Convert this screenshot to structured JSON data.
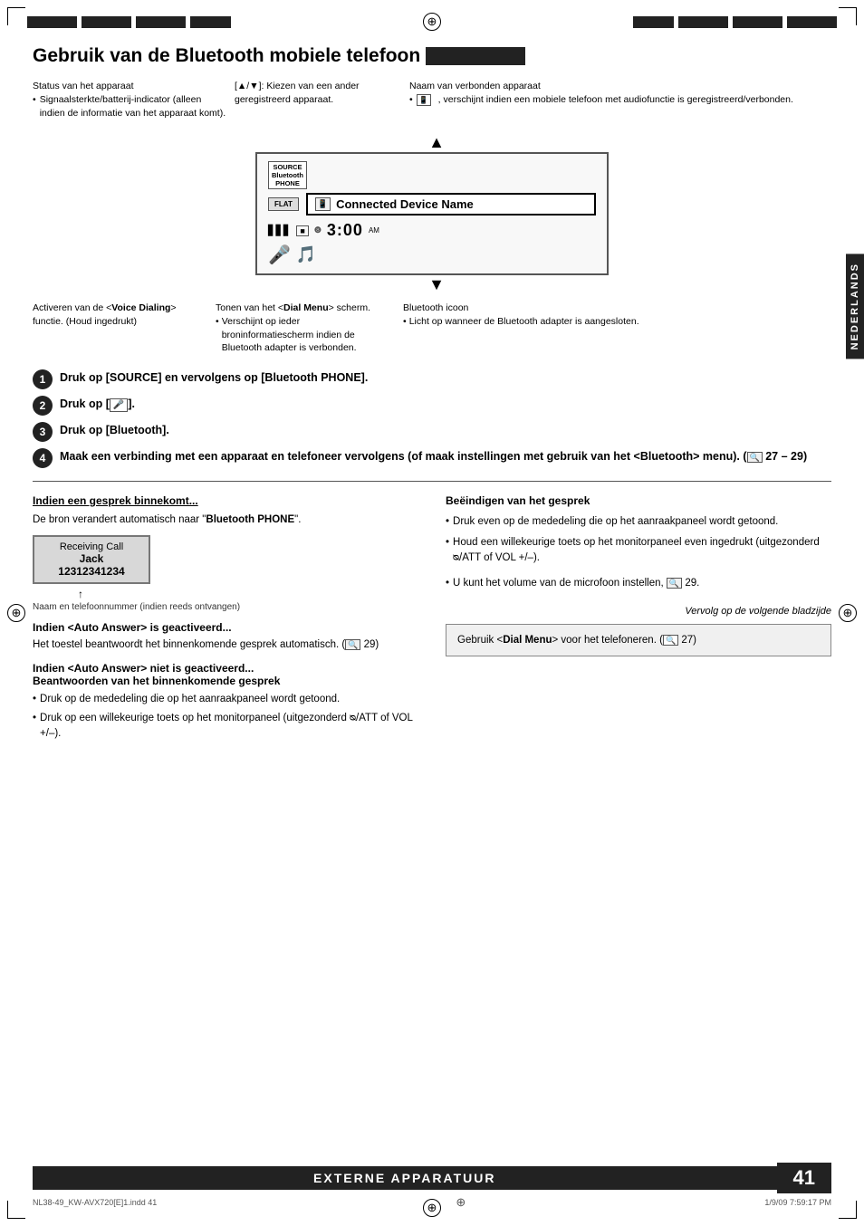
{
  "page": {
    "title": "Gebruik van de Bluetooth mobiele telefoon",
    "title_bar": "■",
    "sidebar_label": "NEDERLANDS"
  },
  "header": {
    "top_bars": [
      "left-bar",
      "right-bar"
    ],
    "reg_symbol": "⊕"
  },
  "desc_top": {
    "col1_label": "Status van het apparaat",
    "col1_bullet": "Signaalsterkte/batterij-indicator (alleen indien de informatie van het apparaat komt).",
    "col2_label": "[▲/▼]: Kiezen van een ander geregistreerd apparaat.",
    "col3_label": "Naam van verbonden apparaat",
    "col3_bullet": ", verschijnt indien een mobiele telefoon met audiofunctie is geregistreerd/verbonden."
  },
  "device": {
    "source_line1": "SOURCE",
    "source_line2": "Bluetooth",
    "source_line3": "PHONE",
    "flat_btn": "FLAT",
    "connected_device_name": "Connected Device Name",
    "time": "3:00",
    "am_label": "AM",
    "signal": "▋▋▋",
    "battery": "■",
    "bt_icon": "❽"
  },
  "diagram_labels": {
    "left_label": "Activeren van de <Voice Dialing> functie. (Houd ingedrukt)",
    "mid_label": "Tonen van het <Dial Menu> scherm.",
    "mid_bullet": "Verschijnt op ieder broninformatiescherm indien de Bluetooth adapter is verbonden.",
    "right_label": "Bluetooth icoon",
    "right_bullet": "Licht op wanneer de Bluetooth adapter is aangesloten."
  },
  "steps": [
    {
      "num": "1",
      "text": "Druk op [SOURCE] en vervolgens op [Bluetooth PHONE]."
    },
    {
      "num": "2",
      "text_pre": "Druk op [",
      "text_icon": "🎤",
      "text_post": "]."
    },
    {
      "num": "3",
      "text": "Druk op [Bluetooth]."
    },
    {
      "num": "4",
      "text": "Maak een verbinding met een apparaat en telefoneer vervolgens (of maak instellingen met gebruik van het <Bluetooth> menu). (",
      "ref": "27 – 29",
      "text_end": ")"
    }
  ],
  "left_section": {
    "title": "Indien een gesprek binnekomt...",
    "intro": "De bron verandert automatisch naar \"Bluetooth PHONE\".",
    "call_box": {
      "line1": "Receiving Call",
      "line2": "Jack",
      "line3": "12312341234"
    },
    "caption": "Naam en telefoonnummer (indien reeds ontvangen)",
    "auto_answer_title": "Indien <Auto Answer> is geactiveerd...",
    "auto_answer_text": "Het toestel beantwoordt het binnenkomende gesprek automatisch. (",
    "auto_answer_ref": "29",
    "auto_not_title": "Indien <Auto Answer> niet is geactiveerd... Beantwoorden van het binnenkomende gesprek",
    "auto_not_b1": "Druk op de mededeling die op het aanraakpaneel wordt getoond.",
    "auto_not_b2": "Druk op een willekeurige toets op het monitorpaneel (uitgezonderd ᴓ/ATT of VOL +/–)."
  },
  "right_section": {
    "title": "Beëindigen van het gesprek",
    "bullet1": "Druk even op de mededeling die op het aanraakpaneel wordt getoond.",
    "bullet2": "Houd een willekeurige toets op het monitorpaneel even ingedrukt (uitgezonderd ᴓ/ATT of VOL +/–).",
    "bullet3_pre": "U kunt het volume van de microfoon instellen,",
    "bullet3_ref": "29",
    "italic_text": "Vervolg op de volgende bladzijde",
    "info_box_pre": "Gebruik <",
    "info_box_bold": "Dial Menu",
    "info_box_mid": "> voor het telefoneren. (",
    "info_box_ref": "27",
    "info_box_end": ")"
  },
  "footer": {
    "file": "NL38-49_KW-AVX720[E]1.indd  41",
    "reg_center": "⊕",
    "date": "1/9/09  7:59:17 PM"
  },
  "bottom_bar": {
    "label": "EXTERNE APPARATUUR",
    "page": "41"
  }
}
